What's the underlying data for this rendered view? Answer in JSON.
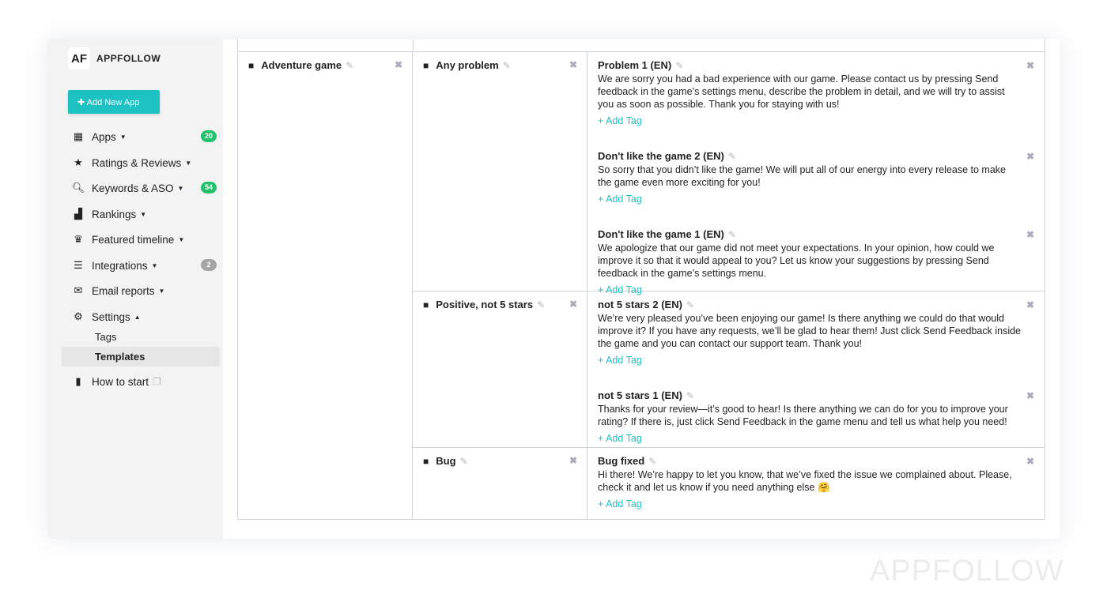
{
  "brand": {
    "logo": "AF",
    "name": "APPFOLLOW",
    "watermark": "APPFOLLOW"
  },
  "sidebar": {
    "add_button": "Add New App",
    "items": [
      {
        "label": "Apps",
        "icon": "grid-icon",
        "badge": "20",
        "caret": true
      },
      {
        "label": "Ratings & Reviews",
        "icon": "star-icon",
        "caret": true
      },
      {
        "label": "Keywords & ASO",
        "icon": "search-icon",
        "badge": "54",
        "caret": true
      },
      {
        "label": "Rankings",
        "icon": "chart-icon",
        "caret": true
      },
      {
        "label": "Featured timeline",
        "icon": "trophy-icon",
        "caret": true
      },
      {
        "label": "Integrations",
        "icon": "sliders-icon",
        "badge": "2",
        "caret": true
      },
      {
        "label": "Email reports",
        "icon": "envelope-icon",
        "caret": true
      },
      {
        "label": "Settings",
        "icon": "gear-icon",
        "caret": true
      },
      {
        "label": "How to start",
        "icon": "book-icon"
      }
    ],
    "settings_sub": [
      {
        "label": "Tags"
      },
      {
        "label": "Templates",
        "active": true
      }
    ]
  },
  "accent": "#1ec1c1",
  "category": "Adventure game",
  "groups": [
    {
      "name": "Any problem",
      "templates": [
        {
          "title": "Problem 1 (EN)",
          "text": "We are sorry you had a bad experience with our game. Please contact us by pressing Send feedback in the game’s settings menu, describe the problem in detail, and we will try to assist you as soon as possible. Thank you for staying with us!"
        },
        {
          "title": "Don't like the game 2 (EN)",
          "text": "So sorry that you didn’t like the game! We will put all of our energy into every release to make the game even more exciting for you!"
        },
        {
          "title": "Don't like the game 1 (EN)",
          "text": "We apologize that our game did not meet your expectations. In your opinion, how could we improve it so that it would appeal to you? Let us know your suggestions by pressing Send feedback in the game’s settings menu."
        }
      ]
    },
    {
      "name": "Positive, not 5 stars",
      "templates": [
        {
          "title": "not 5 stars 2 (EN)",
          "text": "We’re very pleased you’ve been enjoying our game! Is there anything we could do that would improve it? If you have any requests, we’ll be glad to hear them! Just click Send Feedback inside the game and you can contact our support team. Thank you!"
        },
        {
          "title": "not 5 stars 1 (EN)",
          "text": "Thanks for your review—it’s good to hear! Is there anything we can do for you to improve your rating? If there is, just click Send Feedback in the game menu and tell us what help you need!"
        }
      ]
    },
    {
      "name": "Bug",
      "templates": [
        {
          "title": "Bug fixed",
          "text": "Hi there! We’re happy to let you know, that we’ve fixed the issue we complained about. Please, check it and let us know if you need anything else 🤗"
        }
      ]
    }
  ],
  "add_tag_label": "+ Add Tag"
}
